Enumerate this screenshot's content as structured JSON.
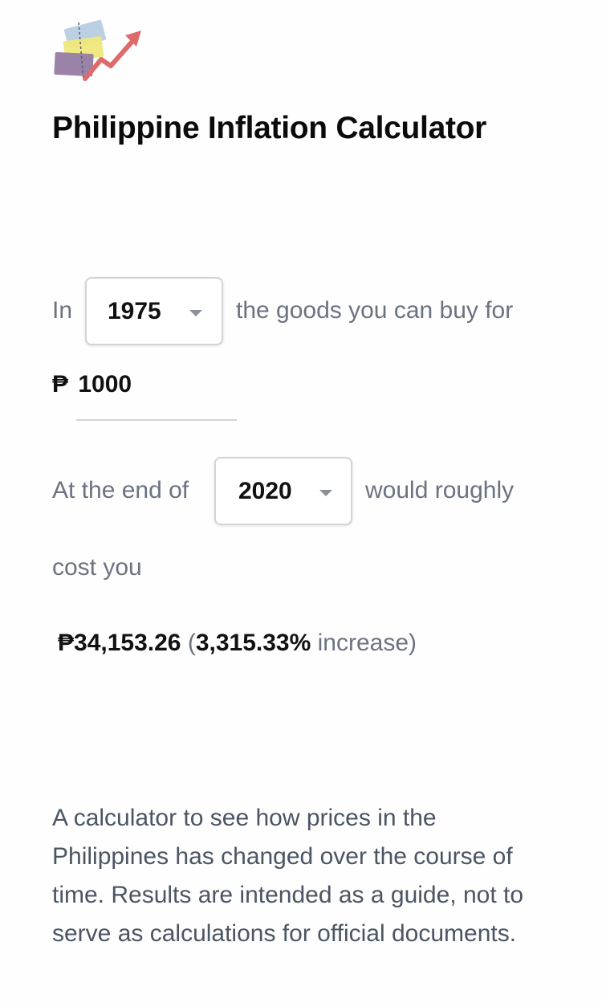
{
  "app": {
    "title": "Philippine Inflation Calculator",
    "logo_icon": "inflation-chart-icon"
  },
  "sentence": {
    "prefix": "In",
    "mid": "the goods you can buy for",
    "currency_symbol": "₱",
    "amount": "1000",
    "end_prefix": "At the end of",
    "end_suffix": "would roughly",
    "cost": "cost you"
  },
  "start_year": {
    "value": "1975"
  },
  "end_year": {
    "value": "2020"
  },
  "result": {
    "amount": "₱34,153.26",
    "open_paren": "(",
    "percent": "3,315.33%",
    "suffix": "increase)"
  },
  "description": "A calculator to see how prices in the Philippines has changed over the course of time. Results are intended as a guide, not to serve as calculations for official documents.",
  "colors": {
    "text": "#111111",
    "muted": "#6b7280",
    "description": "#4b5563",
    "border": "#d4d4d8",
    "arrow": "#de6b6b"
  }
}
